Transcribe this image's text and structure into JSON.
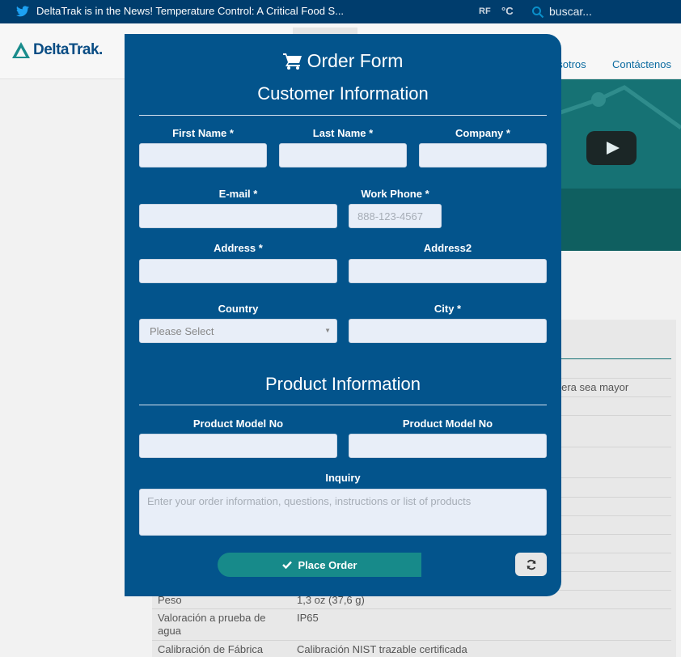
{
  "topbar": {
    "news": "DeltaTrak is in the News! Temperature Control: A Critical Food S...",
    "rf_label": "RF",
    "degree_label": "°C",
    "search_placeholder": "buscar..."
  },
  "nav": {
    "brand": "DeltaTrak.",
    "items": [
      "osotros",
      "Contáctenos"
    ]
  },
  "background_table": {
    "partial_text": "uiera sea mayor",
    "rows": [
      {
        "label": "Peso",
        "value": "1,3 oz (37,6 g)"
      },
      {
        "label": "Valoración a prueba de",
        "label2": "agua",
        "value": "IP65"
      },
      {
        "label": "Calibración de Fábrica",
        "value": "Calibración NIST trazable certificada"
      }
    ]
  },
  "modal": {
    "title": "Order Form",
    "customer_section": "Customer Information",
    "product_section": "Product Information",
    "fields": {
      "first_name": {
        "label": "First Name *",
        "value": ""
      },
      "last_name": {
        "label": "Last Name *",
        "value": ""
      },
      "company": {
        "label": "Company *",
        "value": ""
      },
      "email": {
        "label": "E-mail *",
        "value": ""
      },
      "work_phone": {
        "label": "Work Phone *",
        "placeholder": "888-123-4567",
        "value": ""
      },
      "address": {
        "label": "Address *",
        "value": ""
      },
      "address2": {
        "label": "Address2",
        "value": ""
      },
      "country": {
        "label": "Country",
        "selected": "Please Select"
      },
      "city": {
        "label": "City *",
        "value": ""
      },
      "product_model_1": {
        "label": "Product Model No",
        "value": ""
      },
      "product_model_2": {
        "label": "Product Model No",
        "value": ""
      },
      "inquiry": {
        "label": "Inquiry",
        "placeholder": "Enter your order information, questions, instructions or list of products",
        "value": ""
      }
    },
    "place_order_label": "Place Order"
  },
  "colors": {
    "modal_bg": "#03548c",
    "topbar_bg": "#003d6d",
    "accent_teal": "#178a8a",
    "input_bg": "#e8eef8"
  }
}
